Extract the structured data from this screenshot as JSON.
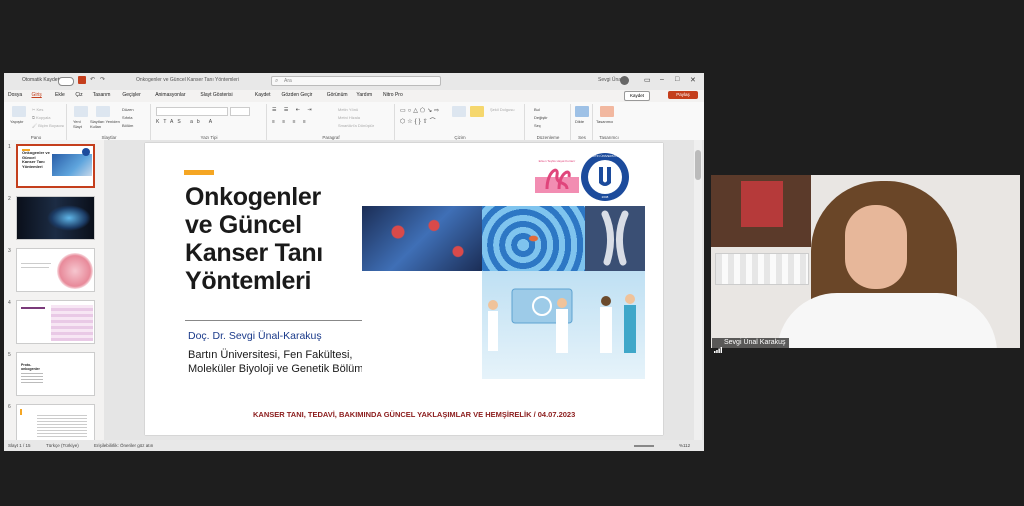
{
  "titlebar": {
    "autosave_label": "Otomatik Kaydet",
    "filename": "Onkogenler ve Güncel Kanser Tanı Yöntemleri",
    "search_placeholder": "Ara",
    "user_name": "Sevgi Ünal"
  },
  "menu": [
    "Dosya",
    "Giriş",
    "Ekle",
    "Çiz",
    "Tasarım",
    "Geçişler",
    "Animasyonlar",
    "Slayt Gösterisi",
    "Kaydet",
    "Gözden Geçir",
    "Görünüm",
    "Yardım",
    "Nitro Pro"
  ],
  "menu_active_index": 1,
  "actions": {
    "save_label": "Kaydet",
    "share_label": "Paylaş"
  },
  "ribbon": {
    "groups": [
      "Pano",
      "Slaytlar",
      "Yazı Tipi",
      "Paragraf",
      "Çizim",
      "Düzenleme",
      "Ses",
      "Tasarımcı"
    ],
    "buttons": {
      "paste": "Yapıştır",
      "new_slide": "Yeni Slayt",
      "reuse": "Slaytları Yeniden Kullan",
      "layout": "Düzen",
      "reset": "Sıfırla",
      "section": "Bölüm",
      "shapes": "Şekil Dolgusu",
      "find": "Bul",
      "replace": "Değiştir",
      "select": "Seç",
      "dictate": "Dikte",
      "designer": "Tasarımcı"
    }
  },
  "thumbnails": [
    {
      "num": "1",
      "text": "Onkogenler ve Güncel Kanser Tanı Yöntemleri",
      "selected": true
    },
    {
      "num": "2",
      "text": "",
      "selected": false
    },
    {
      "num": "3",
      "text": "",
      "selected": false
    },
    {
      "num": "4",
      "text": "",
      "selected": false
    },
    {
      "num": "5",
      "text": "Proto-onkogenler",
      "selected": false
    },
    {
      "num": "6",
      "text": "",
      "selected": false
    }
  ],
  "slide": {
    "title_lines": [
      "Onkogenler",
      "ve Güncel",
      "Kanser Tanı",
      "Yöntemleri"
    ],
    "author": "Doç. Dr. Sevgi Ünal-Karakuş",
    "affiliation_lines": [
      "Bartın Üniversitesi, Fen Fakültesi,",
      "Moleküler Biyoloji ve Genetik Bölümü"
    ],
    "footer": "KANSER TANI, TEDAVİ, BAKIMINDA GÜNCEL YAKLAŞIMLAR VE HEMŞİRELİK / 04.07.2023",
    "logo_bartin_text": "BARTIN ÜNİVERSİTESİ",
    "logo_bartin_year": "2008",
    "ribbon_logo_text": "Erken Teşhis Hayat Kurtarır"
  },
  "statusbar": {
    "slide_count": "Slayt 1 / 15",
    "language": "Türkçe (Türkiye)",
    "accessibility": "Erişilebilirlik: Öneriler göz atın",
    "zoom": "%112"
  },
  "video": {
    "participant_name": "Sevgi Ünal Karakuş"
  }
}
